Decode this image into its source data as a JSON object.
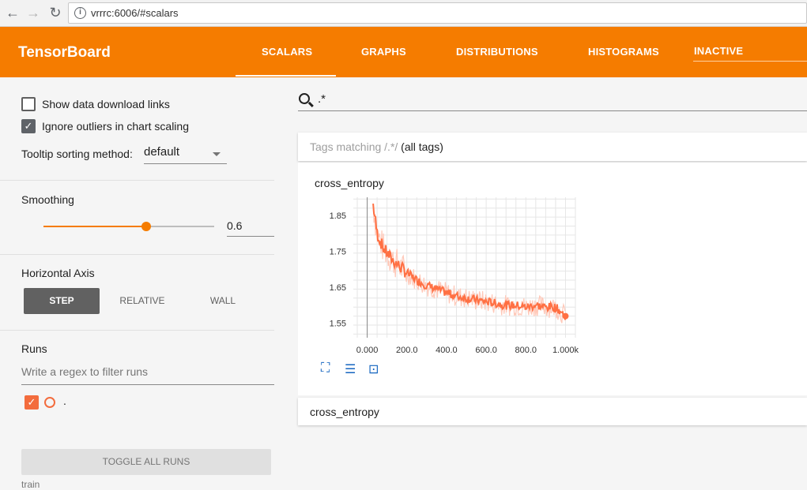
{
  "browser": {
    "url": "vrrrc:6006/#scalars",
    "back_icon": "arrow-left",
    "forward_icon": "arrow-right",
    "reload_icon": "reload",
    "info_icon": "info"
  },
  "topbar": {
    "brand": "TensorBoard",
    "tabs": [
      "SCALARS",
      "GRAPHS",
      "DISTRIBUTIONS",
      "HISTOGRAMS"
    ],
    "inactive_label": "INACTIVE",
    "selected_tab": "SCALARS",
    "color": "#f57c00"
  },
  "sidebar": {
    "show_download_links": "Show data download links",
    "ignore_outliers": "Ignore outliers in chart scaling",
    "tooltip_label": "Tooltip sorting method:",
    "tooltip_value": "default",
    "smoothing_label": "Smoothing",
    "smoothing_value": "0.6",
    "smoothing_fraction": 0.6,
    "horizontal_axis_label": "Horizontal Axis",
    "axis_buttons": [
      "STEP",
      "RELATIVE",
      "WALL"
    ],
    "runs_label": "Runs",
    "regex_placeholder": "Write a regex to filter runs",
    "run_name": ".",
    "toggle_all": "TOGGLE ALL RUNS",
    "train_label": "train",
    "run_color": "#f36c3d"
  },
  "main": {
    "search_value": ".*",
    "tags_prefix": "Tags matching /.*/",
    "tags_suffix": "(all tags)",
    "chart_title": "cross_entropy",
    "bottom_title": "cross_entropy"
  },
  "chart_data": {
    "type": "line",
    "title": "cross_entropy",
    "xlabel": "",
    "ylabel": "",
    "x_ticks": [
      "0.000",
      "200.0",
      "400.0",
      "600.0",
      "800.0",
      "1.000k"
    ],
    "y_ticks": [
      "1.55",
      "1.65",
      "1.75",
      "1.85"
    ],
    "xlim": [
      -70,
      1050
    ],
    "ylim": [
      1.51,
      1.9
    ],
    "series": [
      {
        "color": "#ff7043",
        "x": [
          30,
          50,
          80,
          120,
          160,
          200,
          250,
          300,
          350,
          400,
          450,
          500,
          550,
          600,
          650,
          700,
          750,
          800,
          850,
          900,
          950,
          1000
        ],
        "y": [
          1.88,
          1.8,
          1.76,
          1.73,
          1.71,
          1.69,
          1.67,
          1.655,
          1.645,
          1.635,
          1.625,
          1.62,
          1.615,
          1.61,
          1.605,
          1.6,
          1.6,
          1.595,
          1.6,
          1.595,
          1.595,
          1.57
        ]
      }
    ],
    "grid": true
  }
}
